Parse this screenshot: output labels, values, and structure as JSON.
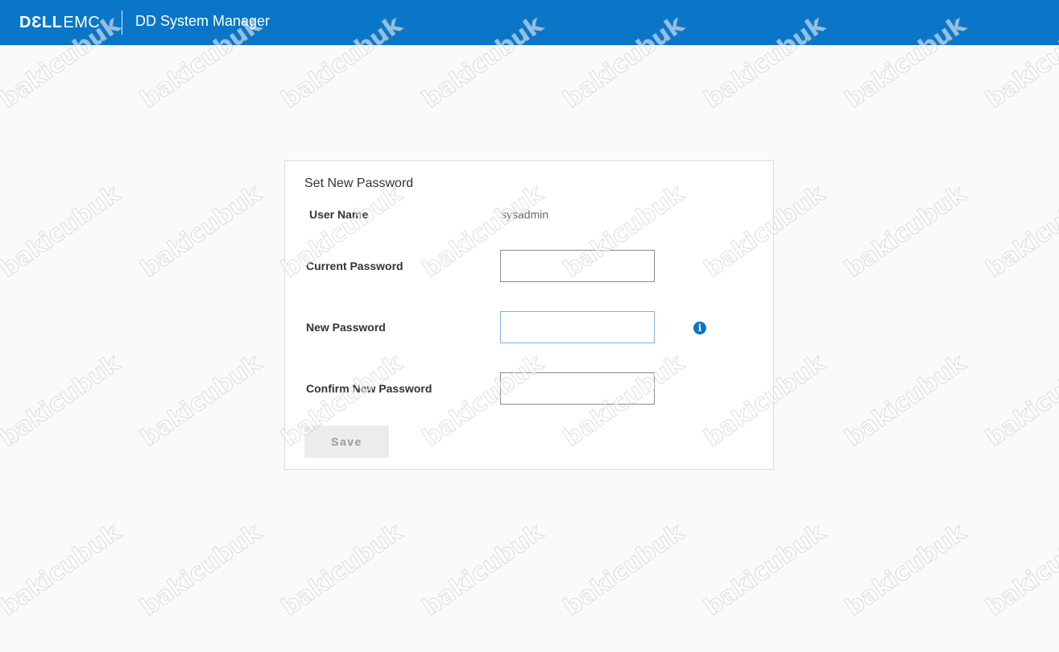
{
  "header": {
    "brand_dell": "DƐLL",
    "brand_emc": "EMC",
    "app_title": "DD System Manager",
    "background_color": "#0a76c8"
  },
  "form": {
    "title": "Set New Password",
    "user_name_label": "User Name",
    "user_name_value": "sysadmin",
    "current_password_label": "Current Password",
    "current_password_value": "",
    "new_password_label": "New Password",
    "new_password_value": "",
    "new_password_info_icon": "info-icon",
    "confirm_password_label": "Confirm New Password",
    "confirm_password_value": "",
    "save_label": "Save"
  },
  "watermark": {
    "text": "bakicubuk"
  }
}
